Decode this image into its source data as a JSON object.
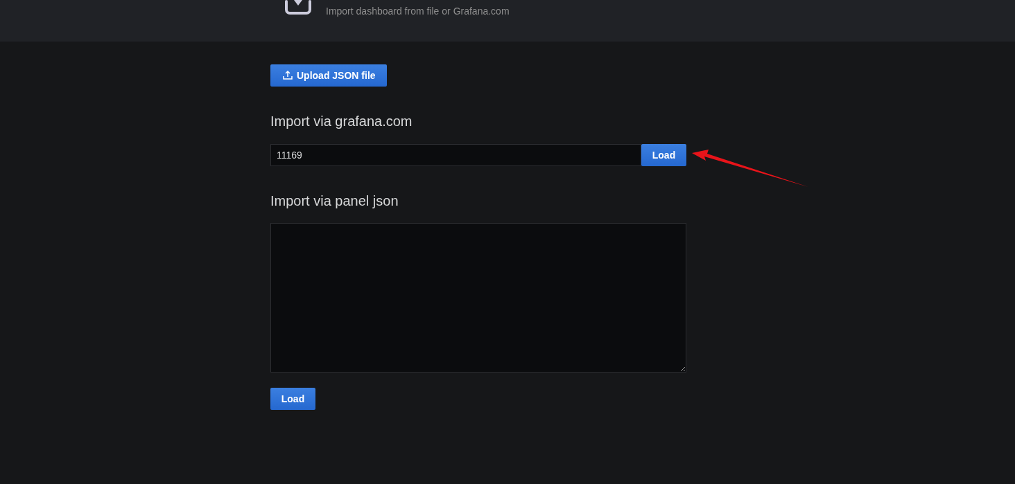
{
  "header": {
    "subtitle": "Import dashboard from file or Grafana.com"
  },
  "upload_button": {
    "label": "Upload JSON file"
  },
  "grafana_import": {
    "heading": "Import via grafana.com",
    "field": {
      "value": "11169"
    },
    "button": "Load"
  },
  "panel_json_import": {
    "heading": "Import via panel json",
    "button": "Load"
  }
}
